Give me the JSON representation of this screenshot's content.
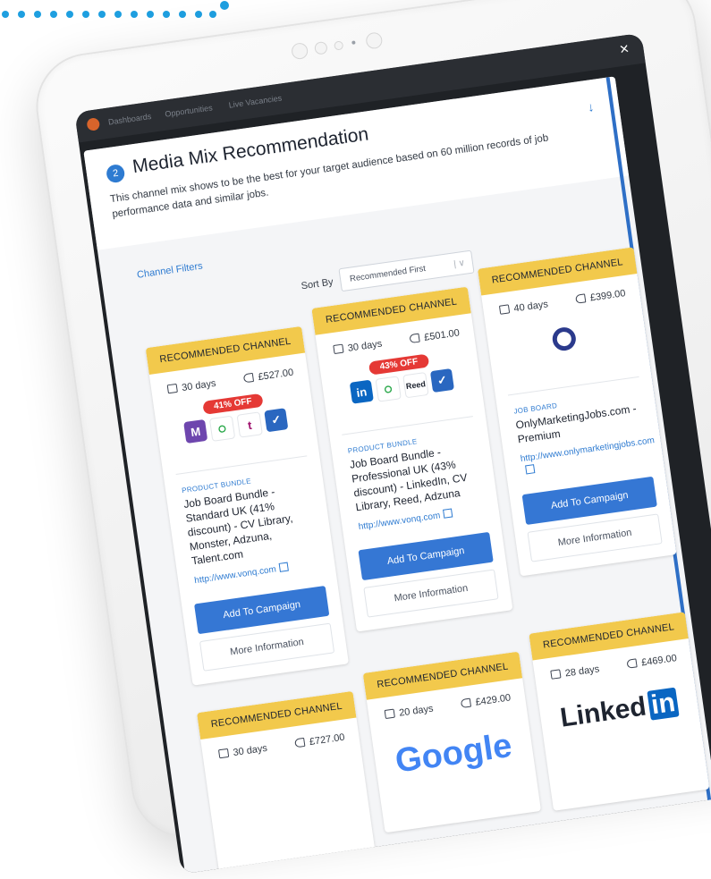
{
  "app": {
    "nav": [
      "Dashboards",
      "Opportunities",
      "Live Vacancies"
    ]
  },
  "panel": {
    "step": "2",
    "title": "Media Mix Recommendation",
    "description": "This channel mix shows to be the best for your target audience based on 60 million records of job performance data and similar jobs.",
    "filters_link": "Channel Filters",
    "sort_label": "Sort By",
    "sort_value": "Recommended First"
  },
  "cards": [
    {
      "banner": "RECOMMENDED CHANNEL",
      "days": "30 days",
      "price": "£527.00",
      "discount": "41% OFF",
      "logos": [
        "Monster",
        "CV Library",
        "Talent.com",
        "Adzuna"
      ],
      "kind": "PRODUCT BUNDLE",
      "name": "Job Board Bundle - Standard UK (41% discount) - CV Library, Monster, Adzuna, Talent.com",
      "url": "http://www.vonq.com",
      "add_label": "Add To Campaign",
      "more_label": "More Information"
    },
    {
      "banner": "RECOMMENDED CHANNEL",
      "days": "30 days",
      "price": "£501.00",
      "discount": "43% OFF",
      "logos": [
        "LinkedIn",
        "CV Library",
        "Reed",
        "Adzuna"
      ],
      "kind": "PRODUCT BUNDLE",
      "name": "Job Board Bundle - Professional UK (43% discount) - LinkedIn, CV Library, Reed, Adzuna",
      "url": "http://www.vonq.com",
      "add_label": "Add To Campaign",
      "more_label": "More Information"
    },
    {
      "banner": "RECOMMENDED CHANNEL",
      "days": "40 days",
      "price": "£399.00",
      "kind": "JOB BOARD",
      "name": "OnlyMarketingJobs.com - Premium",
      "url": "http://www.onlymarketingjobs.com",
      "add_label": "Add To Campaign",
      "more_label": "More Information"
    },
    {
      "banner": "RECOMMENDED CHANNEL",
      "days": "30 days",
      "price": "£727.00"
    },
    {
      "banner": "RECOMMENDED CHANNEL",
      "days": "20 days",
      "price": "£429.00",
      "logo_text": "Google"
    },
    {
      "banner": "RECOMMENDED CHANNEL",
      "days": "28 days",
      "price": "£469.00",
      "logo_text": "Linked",
      "logo_text_2": "in"
    }
  ],
  "colors": {
    "accent": "#2e7bd1",
    "banner": "#f2c94c",
    "discount": "#e53935",
    "button": "#3577d4",
    "dots": "#1e9fe0"
  },
  "icons": [
    "calendar-icon",
    "price-tag-icon",
    "external-link-icon",
    "close-icon",
    "arrow-down-icon",
    "chevron-down-icon"
  ]
}
